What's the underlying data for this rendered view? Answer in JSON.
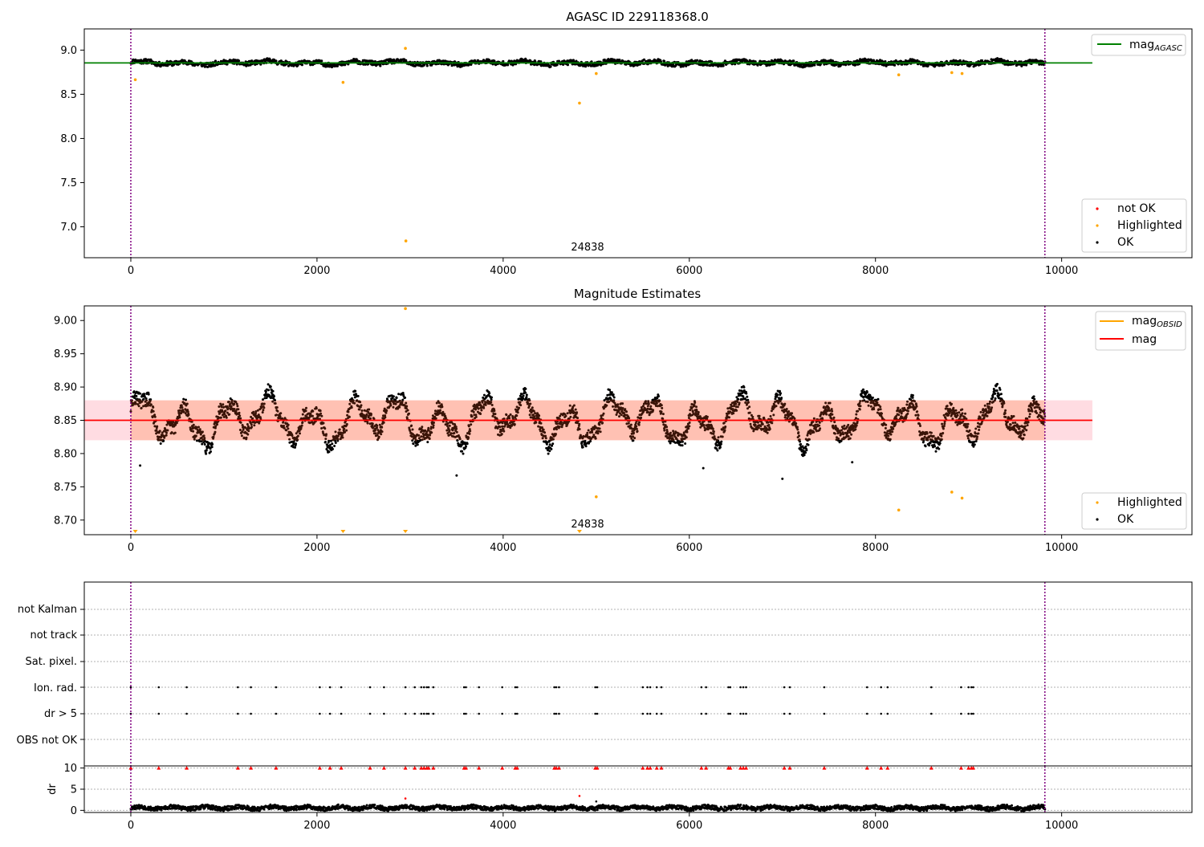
{
  "chart_data": [
    {
      "type": "scatter",
      "title": "AGASC ID 229118368.0",
      "xlim": [
        -500,
        11400
      ],
      "ylim": [
        6.65,
        9.24
      ],
      "xticks": [
        0,
        2000,
        4000,
        6000,
        8000,
        10000
      ],
      "yticks": [
        7.0,
        7.5,
        8.0,
        8.5,
        9.0
      ],
      "vlines": [
        0,
        9820
      ],
      "hline": {
        "name": "mag",
        "sub": "AGASC",
        "value": 8.855,
        "x_range": [
          -500,
          10330
        ],
        "color": "#008000"
      },
      "ok_band": {
        "y_center": 8.855,
        "amplitude": 0.045
      },
      "highlighted_points": [
        [
          48,
          8.665
        ],
        [
          2280,
          8.635
        ],
        [
          2950,
          9.02
        ],
        [
          2955,
          6.84
        ],
        [
          4820,
          8.4
        ],
        [
          5000,
          8.735
        ],
        [
          8250,
          8.72
        ],
        [
          8820,
          8.745
        ],
        [
          8930,
          8.735
        ]
      ],
      "annotation": {
        "text": "24838",
        "x": 4820
      },
      "legend": [
        {
          "label": "not OK",
          "color": "#ff0000"
        },
        {
          "label": "Highlighted",
          "color": "#ffa500"
        },
        {
          "label": "OK",
          "color": "#000000"
        }
      ]
    },
    {
      "type": "scatter",
      "title": "Magnitude Estimates",
      "xlim": [
        -500,
        11400
      ],
      "ylim": [
        8.678,
        9.022
      ],
      "xticks": [
        0,
        2000,
        4000,
        6000,
        8000,
        10000
      ],
      "yticks": [
        8.7,
        8.75,
        8.8,
        8.85,
        8.9,
        8.95,
        9.0
      ],
      "vlines": [
        0,
        9820
      ],
      "mag_line": {
        "value": 8.85,
        "color": "#ff0000"
      },
      "band_pink": [
        8.82,
        8.88
      ],
      "band_orange": [
        8.82,
        8.88
      ],
      "obsid_segments": [
        [
          0,
          9820,
          8.85
        ]
      ],
      "outliers": [
        [
          100,
          8.782
        ],
        [
          3500,
          8.767
        ],
        [
          6150,
          8.778
        ],
        [
          7000,
          8.762
        ],
        [
          7750,
          8.787
        ]
      ],
      "highlighted_points": [
        [
          2950,
          9.018
        ],
        [
          5000,
          8.735
        ],
        [
          8250,
          8.715
        ],
        [
          8820,
          8.742
        ],
        [
          8930,
          8.733
        ]
      ],
      "down_markers_x": [
        48,
        2280,
        2950,
        4820
      ],
      "annotation": {
        "text": "24838",
        "x": 4820
      },
      "legend_lines": [
        {
          "label": "mag",
          "sub": "OBSID",
          "color": "#ffa500"
        },
        {
          "label": "mag",
          "color": "#ff0000"
        }
      ],
      "legend": [
        {
          "label": "Highlighted",
          "color": "#ffa500"
        },
        {
          "label": "OK",
          "color": "#000000"
        }
      ]
    },
    {
      "type": "scatter",
      "categories": [
        "OBS not OK",
        "dr > 5",
        "Ion. rad.",
        "Sat. pixel.",
        "not track",
        "not Kalman"
      ],
      "xlim": [
        -500,
        11400
      ],
      "vlines": [
        0,
        9820
      ],
      "flag_x": [
        0,
        300,
        600,
        1150,
        1290,
        1560,
        2030,
        2140,
        2260,
        2570,
        2720,
        2950,
        3050,
        3120,
        3150,
        3180,
        3200,
        3250,
        3580,
        3600,
        3740,
        3990,
        4130,
        4150,
        4550,
        4570,
        4600,
        4990,
        5010,
        5500,
        5550,
        5580,
        5650,
        5700,
        6130,
        6180,
        6420,
        6440,
        6550,
        6580,
        6610,
        7020,
        7080,
        7450,
        7910,
        8060,
        8130,
        8600,
        8920,
        9000,
        9030,
        9050
      ],
      "flag_rows": [
        "dr > 5",
        "Ion. rad."
      ]
    },
    {
      "type": "scatter",
      "ylabel": "dr",
      "xlim": [
        -500,
        11400
      ],
      "ylim": [
        -0.5,
        10.5
      ],
      "xticks": [
        0,
        2000,
        4000,
        6000,
        8000,
        10000
      ],
      "yticks": [
        0,
        5,
        10
      ],
      "vlines": [
        0,
        9820
      ],
      "dr_base": {
        "mean": 0.6,
        "spread": 0.5
      },
      "dr_extra": [
        [
          2950,
          2.8
        ],
        [
          4820,
          3.4
        ],
        [
          5000,
          2.1
        ]
      ],
      "clipped_x": [
        0,
        300,
        600,
        1150,
        1290,
        1560,
        2030,
        2140,
        2260,
        2570,
        2720,
        2950,
        3050,
        3120,
        3150,
        3180,
        3200,
        3250,
        3580,
        3600,
        3740,
        3990,
        4130,
        4150,
        4550,
        4570,
        4600,
        4990,
        5010,
        5500,
        5550,
        5580,
        5650,
        5700,
        6130,
        6180,
        6420,
        6440,
        6550,
        6580,
        6610,
        7020,
        7080,
        7450,
        7910,
        8060,
        8130,
        8600,
        8920,
        9000,
        9030,
        9050
      ]
    }
  ]
}
